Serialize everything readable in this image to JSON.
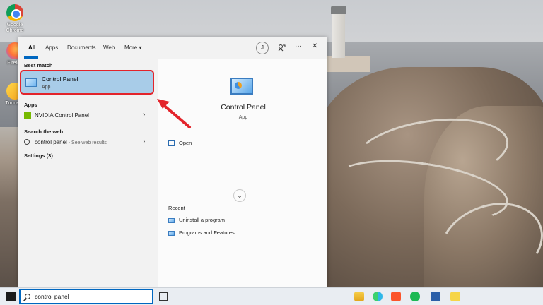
{
  "desktop": {
    "icons": [
      {
        "name": "chrome",
        "label": "Google Chrome"
      },
      {
        "name": "firefox",
        "label": "Firefox"
      },
      {
        "name": "tunnelbear",
        "label": "Tunnel..."
      }
    ]
  },
  "search_panel": {
    "tabs": [
      "All",
      "Apps",
      "Documents",
      "Web",
      "More"
    ],
    "more_caret": "▾",
    "avatar_letter": "J",
    "feedback_icon": "feedback-icon",
    "more_options_icon": "ellipsis-icon",
    "close_icon": "close-icon",
    "best_match_heading": "Best match",
    "best_match": {
      "title": "Control Panel",
      "subtitle": "App"
    },
    "apps_heading": "Apps",
    "apps": [
      {
        "label": "NVIDIA Control Panel"
      }
    ],
    "web_heading": "Search the web",
    "web_result": {
      "query": "control panel",
      "suffix": " - See web results"
    },
    "settings_heading": "Settings (3)",
    "detail": {
      "title": "Control Panel",
      "subtitle": "App",
      "open_label": "Open",
      "recent_heading": "Recent",
      "recent": [
        "Uninstall a program",
        "Programs and Features"
      ]
    }
  },
  "taskbar": {
    "search_value": "control panel",
    "apps": [
      "file-explorer-icon",
      "edge-icon",
      "brave-icon",
      "spotify-icon",
      "store-icon",
      "sticky-notes-icon"
    ]
  },
  "colors": {
    "selection": "#a8cce8",
    "highlight_border": "#e3242b",
    "accent": "#0067c0",
    "arrow": "#e3242b"
  }
}
